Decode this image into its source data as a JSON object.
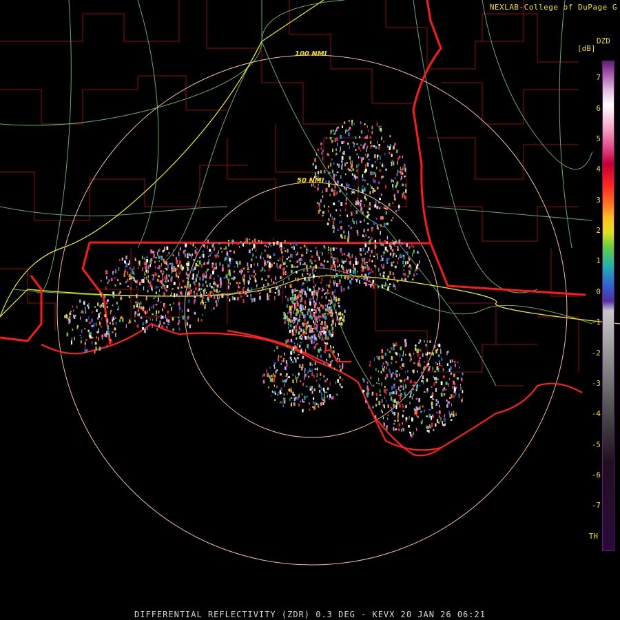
{
  "credit": "NEXLAB-College of DuPage G",
  "product_code": "DZD",
  "unit": "[dB]",
  "footer": "DIFFERENTIAL REFLECTIVITY (ZDR) 0.3 DEG - KEVX 20 JAN 26 06:21",
  "range_rings": [
    {
      "label": "100 NMI",
      "range_nmi": 100
    },
    {
      "label": "50 NMI",
      "range_nmi": 50
    }
  ],
  "colorbar": {
    "ticks": [
      "7",
      "6",
      "5",
      "4",
      "3",
      "2",
      "1",
      "0",
      "-1",
      "-2",
      "-3",
      "-4",
      "-5",
      "-6",
      "-7",
      "TH"
    ]
  },
  "colors": {
    "state_border": "#ff1a1a",
    "county_line": "#b01010",
    "highway": "#f5f500",
    "road": "#80e080",
    "range_ring": "#f0c0a0",
    "text": "#f0e000"
  }
}
